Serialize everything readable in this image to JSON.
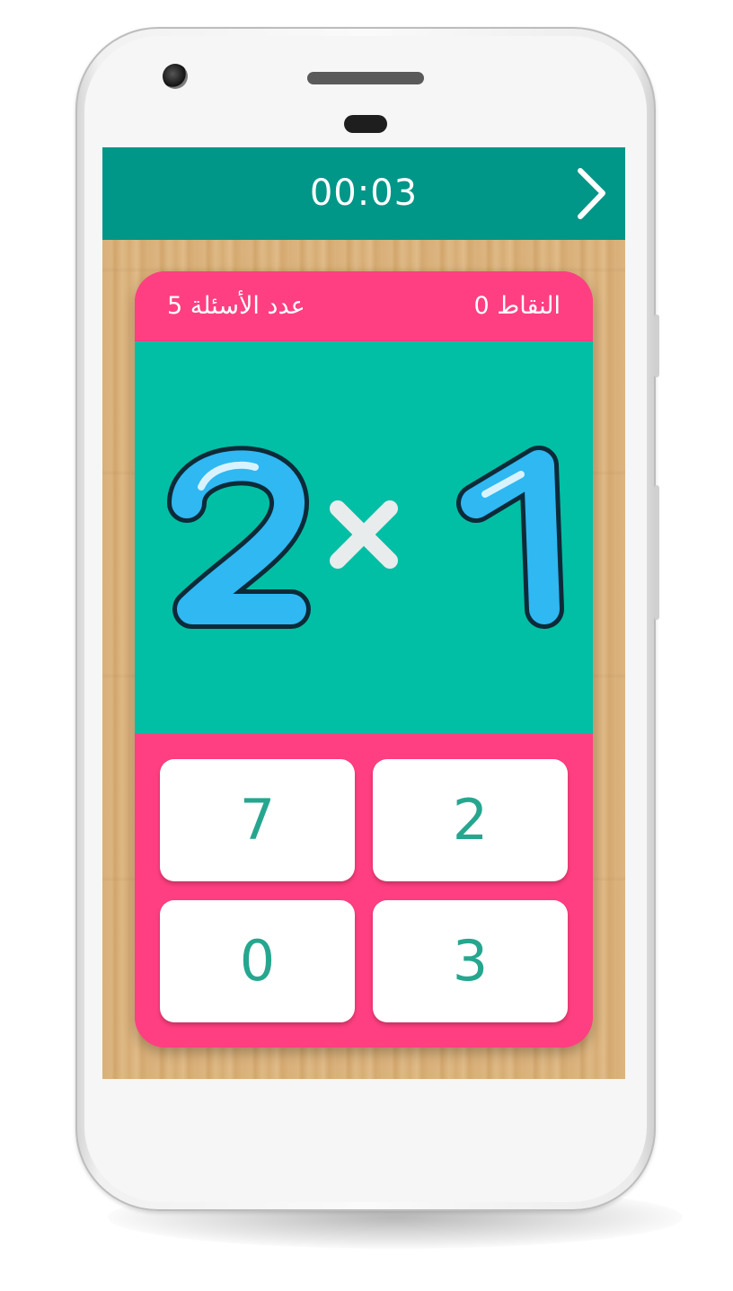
{
  "header": {
    "timer": "00:03",
    "next_icon": "chevron-right-icon"
  },
  "status": {
    "score_text": "النقاط 0",
    "questions_text": "عدد الأسئلة 5"
  },
  "question": {
    "left_operand": "2",
    "operator": "×",
    "right_operand": "1"
  },
  "answers": [
    {
      "label": "7"
    },
    {
      "label": "2"
    },
    {
      "label": "0"
    },
    {
      "label": "3"
    }
  ],
  "colors": {
    "topbar": "#009688",
    "card_pink": "#ff3f81",
    "question_teal": "#00bfa5",
    "digit_blue": "#2fb8f2",
    "answer_text": "#26a68f"
  }
}
